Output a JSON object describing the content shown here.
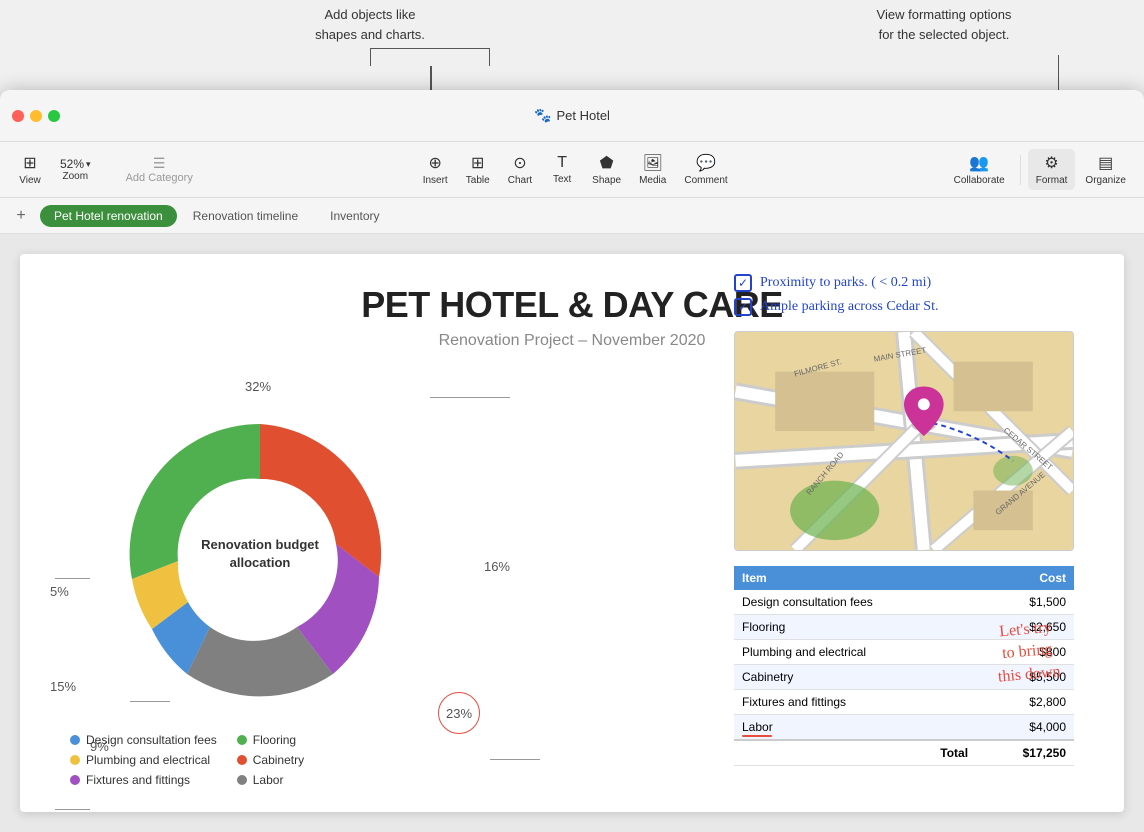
{
  "tooltips": {
    "left_text": "Add objects like\nshapes and charts.",
    "right_text": "View formatting options\nfor the selected object."
  },
  "window": {
    "title": "Pet Hotel",
    "title_icon": "🐾"
  },
  "toolbar": {
    "view_label": "View",
    "zoom_value": "52%",
    "zoom_label": "Zoom",
    "add_category": "Add Category",
    "insert_label": "Insert",
    "table_label": "Table",
    "chart_label": "Chart",
    "text_label": "Text",
    "shape_label": "Shape",
    "media_label": "Media",
    "comment_label": "Comment",
    "collaborate_label": "Collaborate",
    "format_label": "Format",
    "organize_label": "Organize"
  },
  "tabs": {
    "add_label": "+",
    "active_tab": "Pet Hotel renovation",
    "tabs": [
      "Pet Hotel renovation",
      "Renovation timeline",
      "Inventory"
    ]
  },
  "slide": {
    "title": "PET HOTEL & DAY CARE",
    "subtitle": "Renovation Project – November 2020",
    "donut_label": "Renovation budget\nallocation",
    "percentages": {
      "p32": "32%",
      "p16": "16%",
      "p5": "5%",
      "p15": "15%",
      "p9": "9%",
      "p23": "23%"
    },
    "checklist": [
      "Proximity to parks. ( < 0.2 mi)",
      "Ample parking across  Cedar St."
    ],
    "legend": [
      {
        "label": "Design consultation fees",
        "color": "#4a90d9"
      },
      {
        "label": "Plumbing and electrical",
        "color": "#f0c040"
      },
      {
        "label": "Fixtures and fittings",
        "color": "#a050c0"
      },
      {
        "label": "Flooring",
        "color": "#50b050"
      },
      {
        "label": "Cabinetry",
        "color": "#e05030"
      },
      {
        "label": "Labor",
        "color": "#808080"
      }
    ],
    "annotation": "Let's try\nto bring\nthis down"
  },
  "table": {
    "headers": [
      "Item",
      "Cost"
    ],
    "rows": [
      {
        "item": "Design consultation fees",
        "cost": "$1,500"
      },
      {
        "item": "Flooring",
        "cost": "$2,650"
      },
      {
        "item": "Plumbing and electrical",
        "cost": "$800"
      },
      {
        "item": "Cabinetry",
        "cost": "$5,500"
      },
      {
        "item": "Fixtures and fittings",
        "cost": "$2,800"
      },
      {
        "item": "Labor",
        "cost": "$4,000",
        "highlight": true
      }
    ],
    "total_label": "Total",
    "total_value": "$17,250"
  }
}
